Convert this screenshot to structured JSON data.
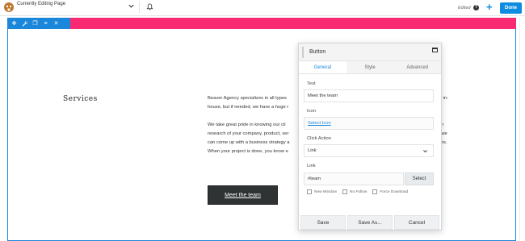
{
  "topbar": {
    "title": "Currently Editing Page",
    "status": "Edited",
    "help": "?",
    "add_label": "+",
    "done_label": "Done"
  },
  "row_actions": {
    "icons": [
      "move-icon",
      "wrench-icon",
      "duplicate-icon",
      "menu-icon",
      "close-icon"
    ],
    "glyphs": [
      "✥",
      "✎",
      "❐",
      "≡",
      "✕"
    ]
  },
  "content": {
    "heading": "Services",
    "para1_left": [
      "Beaver Agency specializes in all types",
      "house, but if needed, we have a huge r"
    ],
    "para1_right": [
      "ces in-",
      ""
    ],
    "para2_left": [
      "We take great pride in knowing our cli",
      "research of your company, product, ser",
      "can come up with a business strategy a",
      "When your project is done, you know e"
    ],
    "para2_right": [
      "epth",
      "%, we",
      "takes.",
      ""
    ],
    "button_label": "Meet the team"
  },
  "panel": {
    "title": "Button",
    "tabs": [
      "General",
      "Style",
      "Advanced"
    ],
    "active_tab": "General",
    "text_label": "Text",
    "text_value": "Meet the team",
    "icon_label": "Icon",
    "icon_link": "Select Icon",
    "click_label": "Click Action",
    "click_value": "Link",
    "link_label": "Link",
    "link_value": "#team",
    "select_btn": "Select",
    "checkboxes": [
      "New Window",
      "No Follow",
      "Force Download"
    ],
    "footer": [
      "Save",
      "Save As...",
      "Cancel"
    ]
  },
  "colors": {
    "accent": "#0e8ce0",
    "row_highlight": "#f92a72",
    "row_outline": "#1a87da",
    "button_bg": "#2f3333"
  }
}
